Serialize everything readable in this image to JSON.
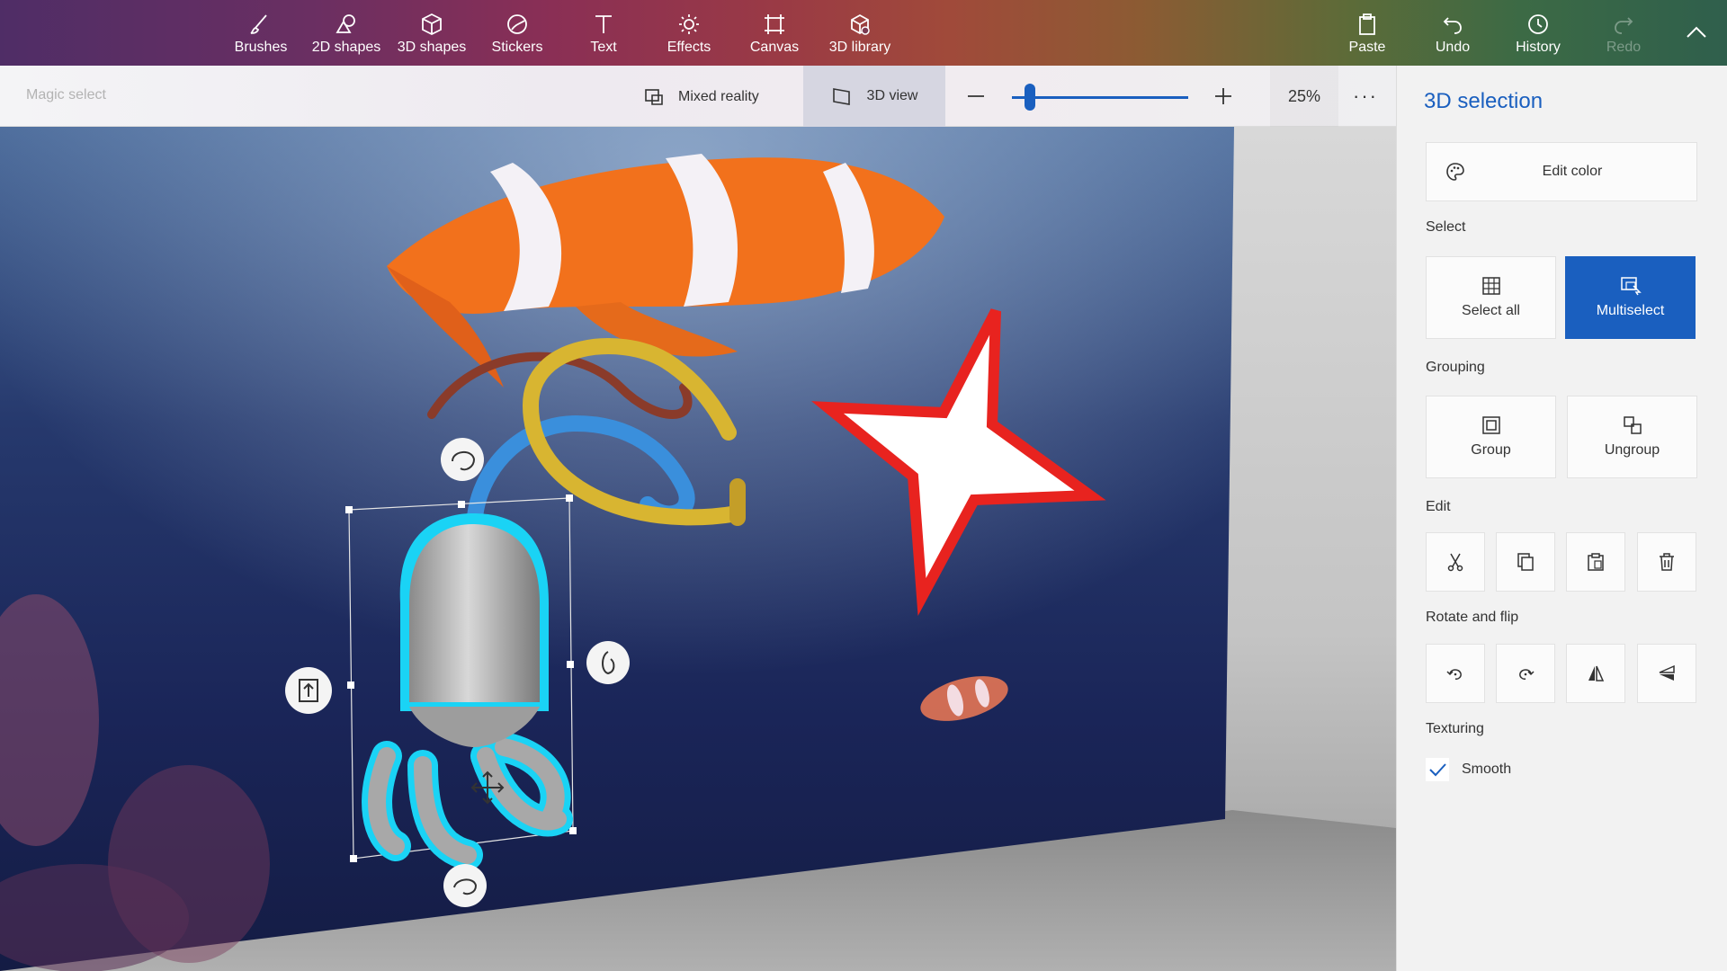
{
  "toolbar": {
    "items": [
      {
        "label": "Brushes",
        "icon": "brush-icon"
      },
      {
        "label": "2D shapes",
        "icon": "2d-shapes-icon"
      },
      {
        "label": "3D shapes",
        "icon": "3d-shapes-icon"
      },
      {
        "label": "Stickers",
        "icon": "stickers-icon"
      },
      {
        "label": "Text",
        "icon": "text-icon"
      },
      {
        "label": "Effects",
        "icon": "effects-icon"
      },
      {
        "label": "Canvas",
        "icon": "canvas-icon"
      },
      {
        "label": "3D library",
        "icon": "3d-library-icon"
      }
    ],
    "paste": "Paste",
    "undo": "Undo",
    "history": "History",
    "redo": "Redo"
  },
  "subbar": {
    "magic_select": "Magic select",
    "mixed_reality": "Mixed reality",
    "view_3d": "3D view",
    "zoom": "25%",
    "zoom_level": 0.07,
    "more": "···"
  },
  "pane": {
    "title": "3D selection",
    "edit_color": "Edit color",
    "select_label": "Select",
    "select_all": "Select all",
    "multiselect": "Multiselect",
    "grouping_label": "Grouping",
    "group": "Group",
    "ungroup": "Ungroup",
    "edit_label": "Edit",
    "rotate_label": "Rotate and flip",
    "texturing_label": "Texturing",
    "smooth": "Smooth",
    "smooth_checked": true
  },
  "colors": {
    "accent": "#1a5fbf",
    "selection_glow": "#1ad3f5",
    "star_outline": "#e8231f"
  }
}
